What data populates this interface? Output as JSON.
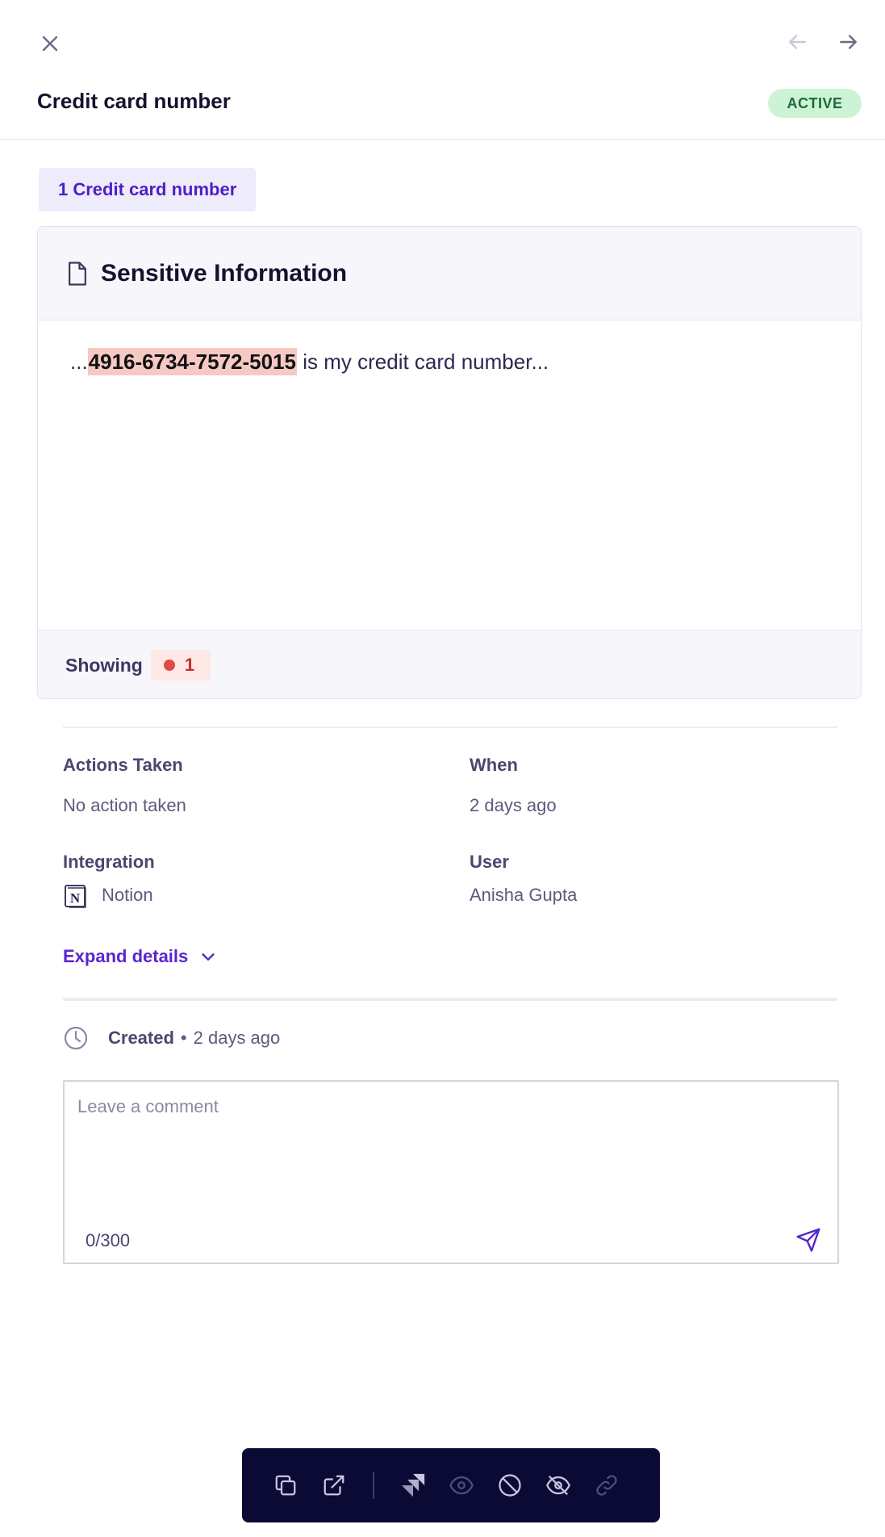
{
  "header": {
    "title": "Credit card number",
    "status": "ACTIVE"
  },
  "chip": {
    "label": "1 Credit card number"
  },
  "card": {
    "title": "Sensitive Information",
    "snippet_prefix": "...",
    "snippet_match": "4916-6734-7572-5015",
    "snippet_suffix": " is my credit card number...",
    "showing_label": "Showing",
    "match_count": "1"
  },
  "details": {
    "actions_label": "Actions Taken",
    "actions_value": "No action taken",
    "when_label": "When",
    "when_value": "2 days ago",
    "integration_label": "Integration",
    "integration_value": "Notion",
    "user_label": "User",
    "user_value": "Anisha Gupta",
    "expand_label": "Expand details"
  },
  "history": {
    "event": "Created",
    "separator": "•",
    "time": "2 days ago"
  },
  "comment": {
    "placeholder": "Leave a comment",
    "value": "",
    "counter": "0/300"
  },
  "toolbar": {
    "icons": [
      "copy-icon",
      "external-link-icon",
      "jira-icon",
      "eye-icon",
      "block-icon",
      "eye-off-icon",
      "link-icon"
    ]
  },
  "colors": {
    "accent": "#5a24d0",
    "status_bg": "#cdf3d6",
    "status_text": "#1e6b38",
    "highlight": "#f6c9c5",
    "danger": "#e04a43",
    "toolbar_bg": "#0b0a35"
  }
}
